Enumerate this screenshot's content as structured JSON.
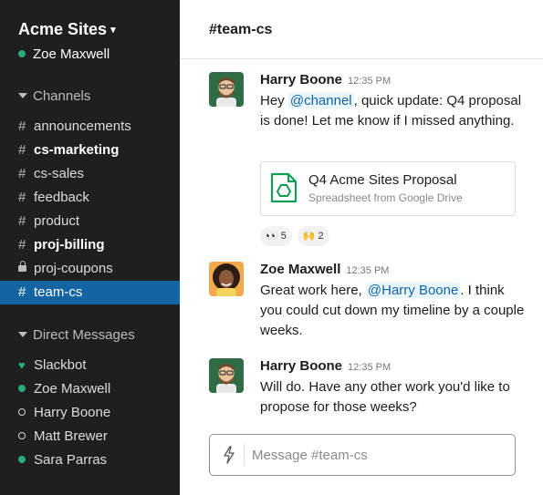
{
  "workspace": {
    "name": "Acme Sites",
    "current_user": "Zoe Maxwell"
  },
  "sidebar": {
    "channels_header": "Channels",
    "channels": [
      {
        "label": "announcements",
        "bold": false,
        "private": false,
        "active": false
      },
      {
        "label": "cs-marketing",
        "bold": true,
        "private": false,
        "active": false
      },
      {
        "label": "cs-sales",
        "bold": false,
        "private": false,
        "active": false
      },
      {
        "label": "feedback",
        "bold": false,
        "private": false,
        "active": false
      },
      {
        "label": "product",
        "bold": false,
        "private": false,
        "active": false
      },
      {
        "label": "proj-billing",
        "bold": true,
        "private": false,
        "active": false
      },
      {
        "label": "proj-coupons",
        "bold": false,
        "private": true,
        "active": false
      },
      {
        "label": "team-cs",
        "bold": false,
        "private": false,
        "active": true
      }
    ],
    "channel_prefix": "#",
    "dm_header": "Direct Messages",
    "direct_messages": [
      {
        "label": "Slackbot",
        "status": "heart-icon"
      },
      {
        "label": "Zoe Maxwell",
        "status": "online"
      },
      {
        "label": "Harry Boone",
        "status": "away"
      },
      {
        "label": "Matt Brewer",
        "status": "away"
      },
      {
        "label": "Sara Parras",
        "status": "online"
      }
    ]
  },
  "header": {
    "channel_title": "#team-cs"
  },
  "messages": [
    {
      "author": "Harry Boone",
      "time": "12:35 PM",
      "text_before": "Hey ",
      "mention": "@channel",
      "text_after": ", quick update: Q4 proposal is done! Let me know if I missed anything.",
      "attachment": {
        "title": "Q4 Acme Sites Proposal",
        "subtitle": "Spreadsheet from Google Drive",
        "icon": "google-drive-icon"
      },
      "reactions": [
        {
          "emoji": "👀",
          "count": "5"
        },
        {
          "emoji": "🙌",
          "count": "2"
        }
      ]
    },
    {
      "author": "Zoe Maxwell",
      "time": "12:35 PM",
      "text_before": "Great work here, ",
      "mention": "@Harry Boone",
      "text_after": ". I think you could cut down my timeline by a couple weeks."
    },
    {
      "author": "Harry Boone",
      "time": "12:35 PM",
      "text": "Will do. Have any other work you'd like to propose for those weeks?"
    }
  ],
  "composer": {
    "placeholder": "Message #team-cs",
    "icon": "lightning-icon"
  },
  "colors": {
    "sidebar_bg": "#1f1f1f",
    "active_channel": "#1264a3",
    "online": "#2bac76",
    "mention": "#1264a3",
    "drive_green": "#0f9d58"
  }
}
